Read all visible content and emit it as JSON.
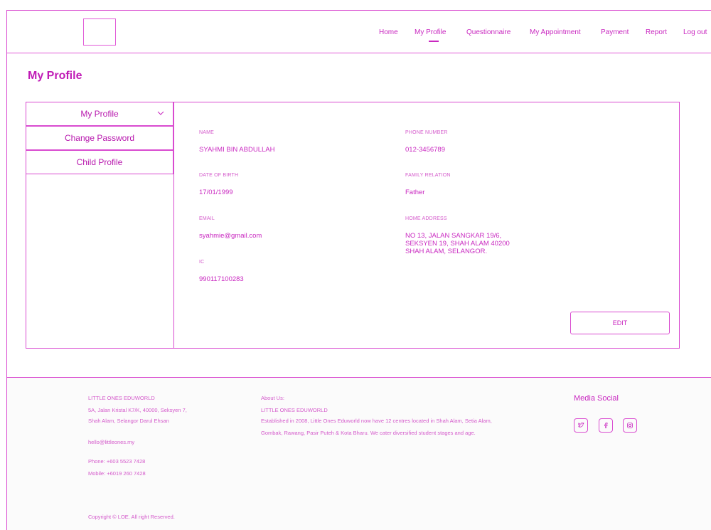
{
  "nav": {
    "home": "Home",
    "my_profile": "My Profile",
    "questionnaire": "Questionnaire",
    "my_appointment": "My Appointment",
    "payment": "Payment",
    "report": "Report",
    "logout": "Log out"
  },
  "page_title": "My Profile",
  "sidebar": {
    "items": [
      {
        "label": "My Profile"
      },
      {
        "label": "Change Password"
      },
      {
        "label": "Child Profile"
      }
    ]
  },
  "profile": {
    "name_label": "NAME",
    "name": "SYAHMI BIN ABDULLAH",
    "phone_label": "PHONE NUMBER",
    "phone": "012-3456789",
    "dob_label": "DATE OF BIRTH",
    "dob": "17/01/1999",
    "relation_label": "FAMILY RELATION",
    "relation": "Father",
    "email_label": "EMAIL",
    "email": "syahmie@gmail.com",
    "address_label": "HOME ADDRESS",
    "address_lines": [
      "NO 13, JALAN SANGKAR 19/6,",
      "SEKSYEN 19, SHAH ALAM 40200",
      "SHAH ALAM, SELANGOR."
    ],
    "ic_label": "IC",
    "ic": "990117100283",
    "edit_label": "EDIT"
  },
  "footer": {
    "company": "LITTLE ONES EDUWORLD",
    "address1": "5A, Jalan Kristal K7/K, 40000, Seksyen 7,",
    "address2": "Shah Alam, Selangor Darul Ehsan",
    "email": "hello@littleones.my",
    "phone": "Phone: +603 5523 7428",
    "mobile": "Mobile: +6019 260 7428",
    "copyright": "Copyright © LOE. All right Reserved.",
    "about_title": "About Us:",
    "about_name": "LITTLE ONES EDUWORLD",
    "about_line1": "Established in 2008, Little Ones Eduworld now have 12 centres located in Shah Alam, Setia Alam,",
    "about_line2": "Gombak, Rawang, Pasir Puteh & Kota Bharu.  We cater diversified student stages and age.",
    "media_title": "Media Social"
  },
  "icons": {
    "twitter": "twitter-icon",
    "facebook": "facebook-icon",
    "instagram": "instagram-icon",
    "chevron": "chevron-down-icon"
  },
  "colors": {
    "accent": "#c928c0",
    "border": "#d94bd0"
  }
}
